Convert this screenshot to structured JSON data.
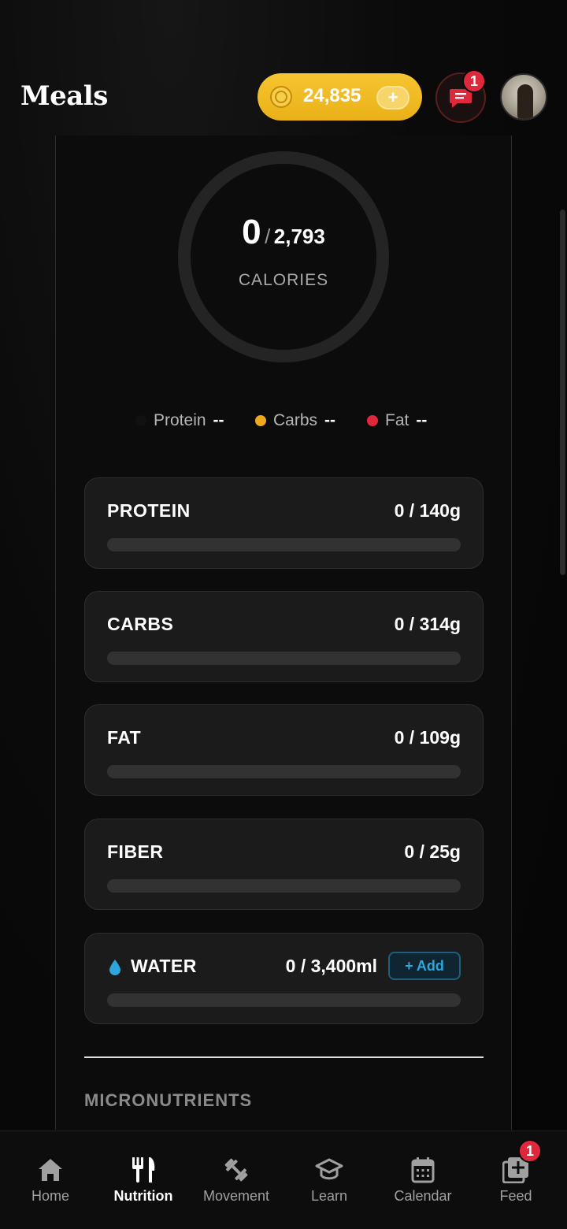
{
  "header": {
    "title": "Meals",
    "coins": "24,835",
    "coin_plus": "+",
    "chat_badge": "1"
  },
  "calories": {
    "eaten": "0",
    "separator": "/",
    "goal": "2,793",
    "label": "CALORIES"
  },
  "legend": [
    {
      "name": "Protein",
      "value": "--",
      "color": "#111111"
    },
    {
      "name": "Carbs",
      "value": "--",
      "color": "#f0a91c"
    },
    {
      "name": "Fat",
      "value": "--",
      "color": "#e0283d"
    }
  ],
  "macros": [
    {
      "name": "PROTEIN",
      "value": "0 / 140g",
      "progress": 0
    },
    {
      "name": "CARBS",
      "value": "0 / 314g",
      "progress": 0
    },
    {
      "name": "FAT",
      "value": "0 / 109g",
      "progress": 0
    },
    {
      "name": "FIBER",
      "value": "0 / 25g",
      "progress": 0
    }
  ],
  "water": {
    "name": "WATER",
    "value": "0 / 3,400ml",
    "add_label": "+ Add",
    "progress": 0,
    "icon_color": "#2ea6dc"
  },
  "micronutrients_title": "MICRONUTRIENTS",
  "nav": {
    "items": [
      {
        "label": "Home",
        "icon": "home-icon"
      },
      {
        "label": "Nutrition",
        "icon": "utensils-icon",
        "active": true
      },
      {
        "label": "Movement",
        "icon": "dumbbell-icon"
      },
      {
        "label": "Learn",
        "icon": "graduation-cap-icon"
      },
      {
        "label": "Calendar",
        "icon": "calendar-icon"
      },
      {
        "label": "Feed",
        "icon": "plus-square-icon"
      }
    ],
    "feed_badge": "1"
  },
  "colors": {
    "accent_gold": "#f6c531",
    "badge_red": "#e0283d",
    "water_blue": "#2ea6dc"
  }
}
